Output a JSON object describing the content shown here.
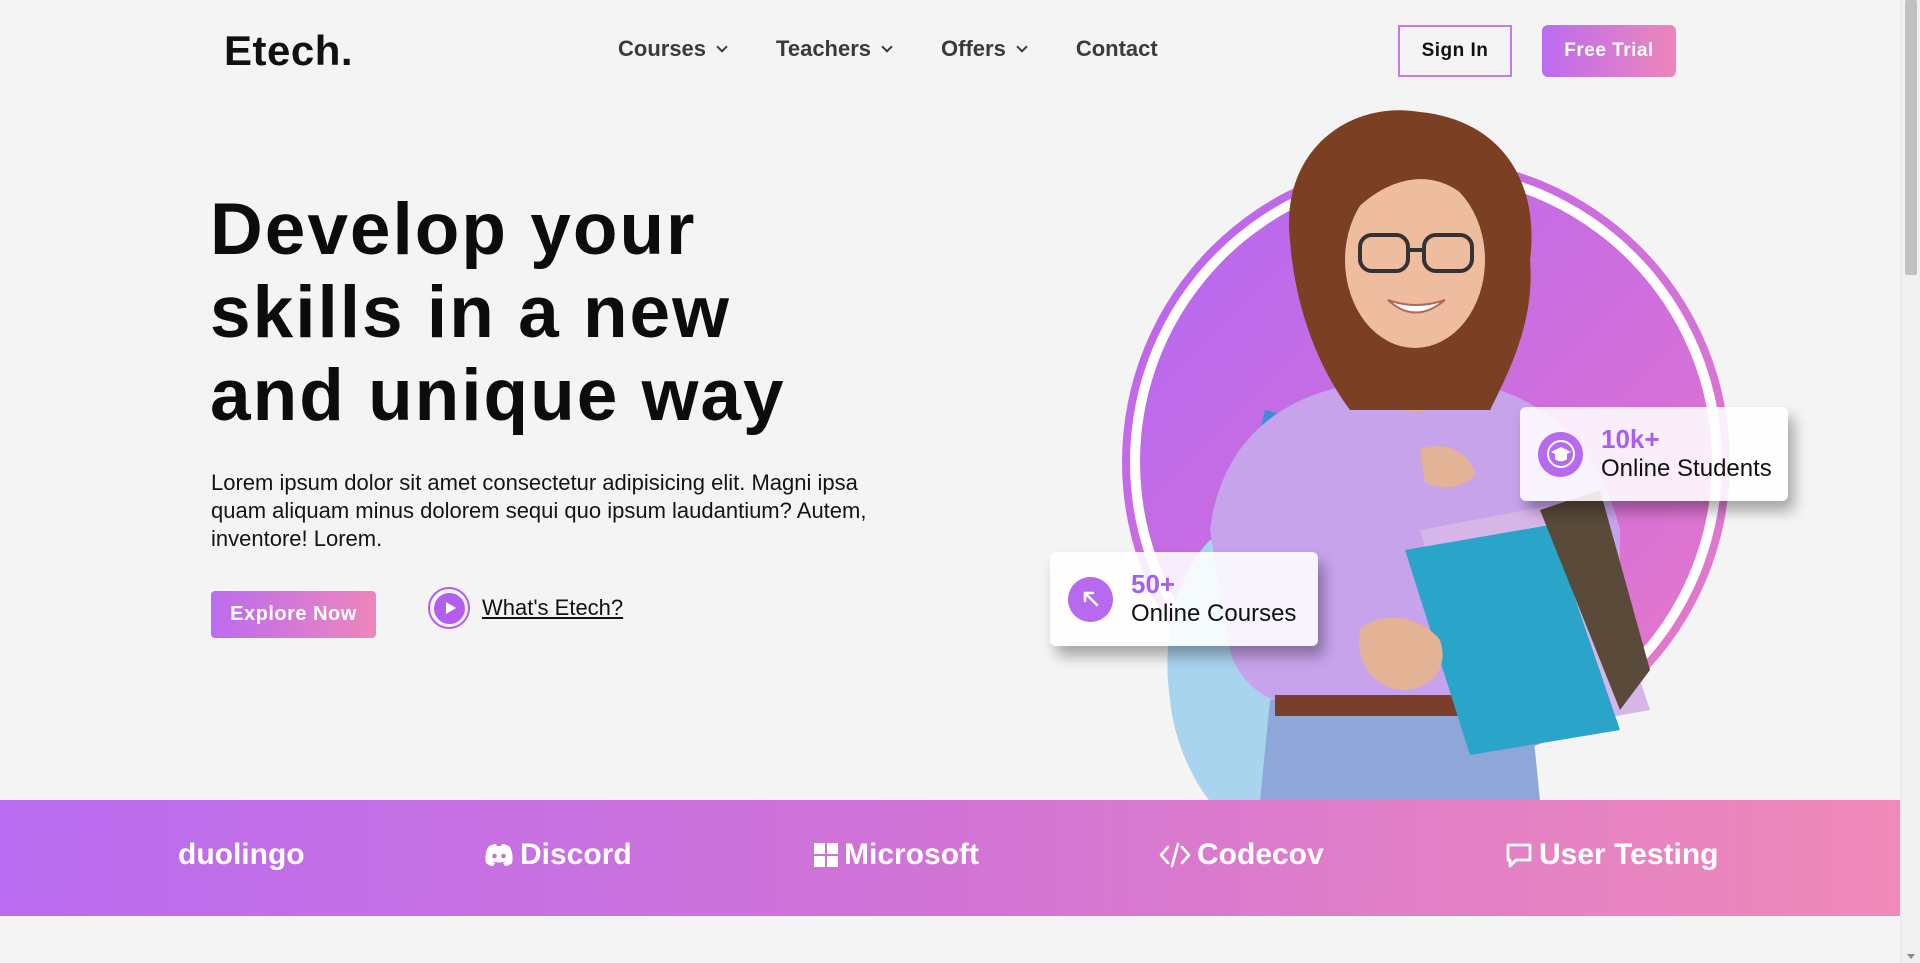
{
  "header": {
    "logo": "Etech.",
    "nav": [
      {
        "label": "Courses",
        "dropdown": true
      },
      {
        "label": "Teachers",
        "dropdown": true
      },
      {
        "label": "Offers",
        "dropdown": true
      },
      {
        "label": "Contact",
        "dropdown": false
      }
    ],
    "sign_in": "Sign In",
    "free_trial": "Free Trial"
  },
  "hero": {
    "title_lines": [
      "Develop your",
      "skills in a new",
      "and unique way"
    ],
    "description": "Lorem ipsum dolor sit amet consectetur adipisicing elit. Magni ipsa quam aliquam minus dolorem sequi quo ipsum laudantium? Autem, inventore! Lorem.",
    "explore_button": "Explore Now",
    "video_link": "What's Etech?"
  },
  "stats": {
    "students": {
      "number": "10k+",
      "label": "Online Students",
      "icon": "graduation-cap-icon"
    },
    "courses": {
      "number": "50+",
      "label": "Online Courses",
      "icon": "arrow-up-left-icon"
    }
  },
  "brands": [
    {
      "name": "duolingo",
      "icon": ""
    },
    {
      "name": "Discord",
      "icon": "discord-icon"
    },
    {
      "name": "Microsoft",
      "icon": "microsoft-icon"
    },
    {
      "name": "Codecov",
      "icon": "code-icon"
    },
    {
      "name": "User Testing",
      "icon": "chat-bubble-icon"
    }
  ],
  "colors": {
    "accent_start": "#bb6cf0",
    "accent_end": "#ee86bb",
    "accent_purple": "#a85ff0",
    "background": "#f4f4f4"
  }
}
